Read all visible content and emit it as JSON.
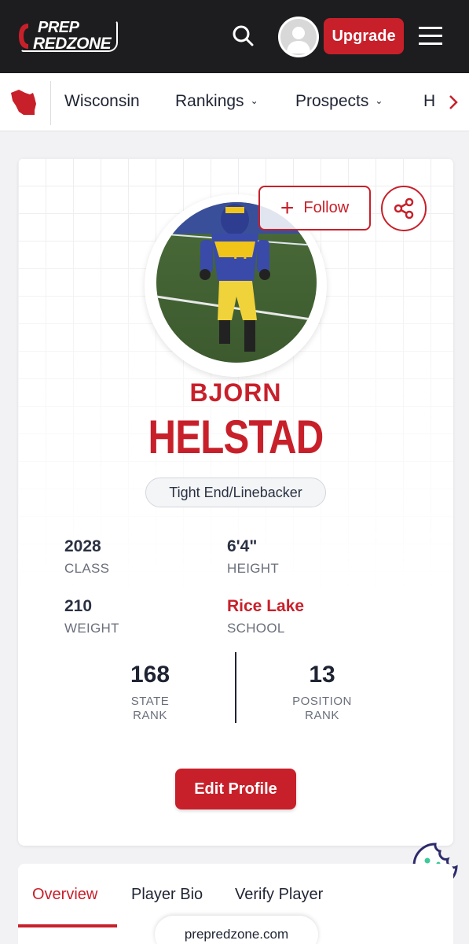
{
  "brand": {
    "line1": "PREP",
    "line2": "REDZONE"
  },
  "header": {
    "upgrade_label": "Upgrade"
  },
  "nav": {
    "state": "Wisconsin",
    "items": [
      {
        "label": "Rankings",
        "chevron": "⌄"
      },
      {
        "label": "Prospects",
        "chevron": "⌄"
      },
      {
        "label": "H"
      }
    ]
  },
  "player": {
    "first_name": "BJORN",
    "last_name": "HELSTAD",
    "position": "Tight End/Linebacker",
    "follow_label": "Follow",
    "stats": [
      {
        "value": "2028",
        "label": "CLASS"
      },
      {
        "value": "6'4\"",
        "label": "HEIGHT"
      },
      {
        "value": "210",
        "label": "WEIGHT"
      },
      {
        "value": "Rice Lake",
        "label": "SCHOOL"
      }
    ],
    "ranks": [
      {
        "value": "168",
        "label_line1": "STATE",
        "label_line2": "RANK"
      },
      {
        "value": "13",
        "label_line1": "POSITION",
        "label_line2": "RANK"
      }
    ],
    "edit_label": "Edit Profile"
  },
  "tabs": [
    {
      "label": "Overview",
      "active": true
    },
    {
      "label": "Player Bio",
      "active": false
    },
    {
      "label": "Verify Player",
      "active": false
    }
  ],
  "footer": {
    "domain": "prepredzone.com"
  },
  "colors": {
    "brand_red": "#c8202a",
    "header_bg": "#1d1d1f",
    "text_dark": "#1f2433"
  }
}
